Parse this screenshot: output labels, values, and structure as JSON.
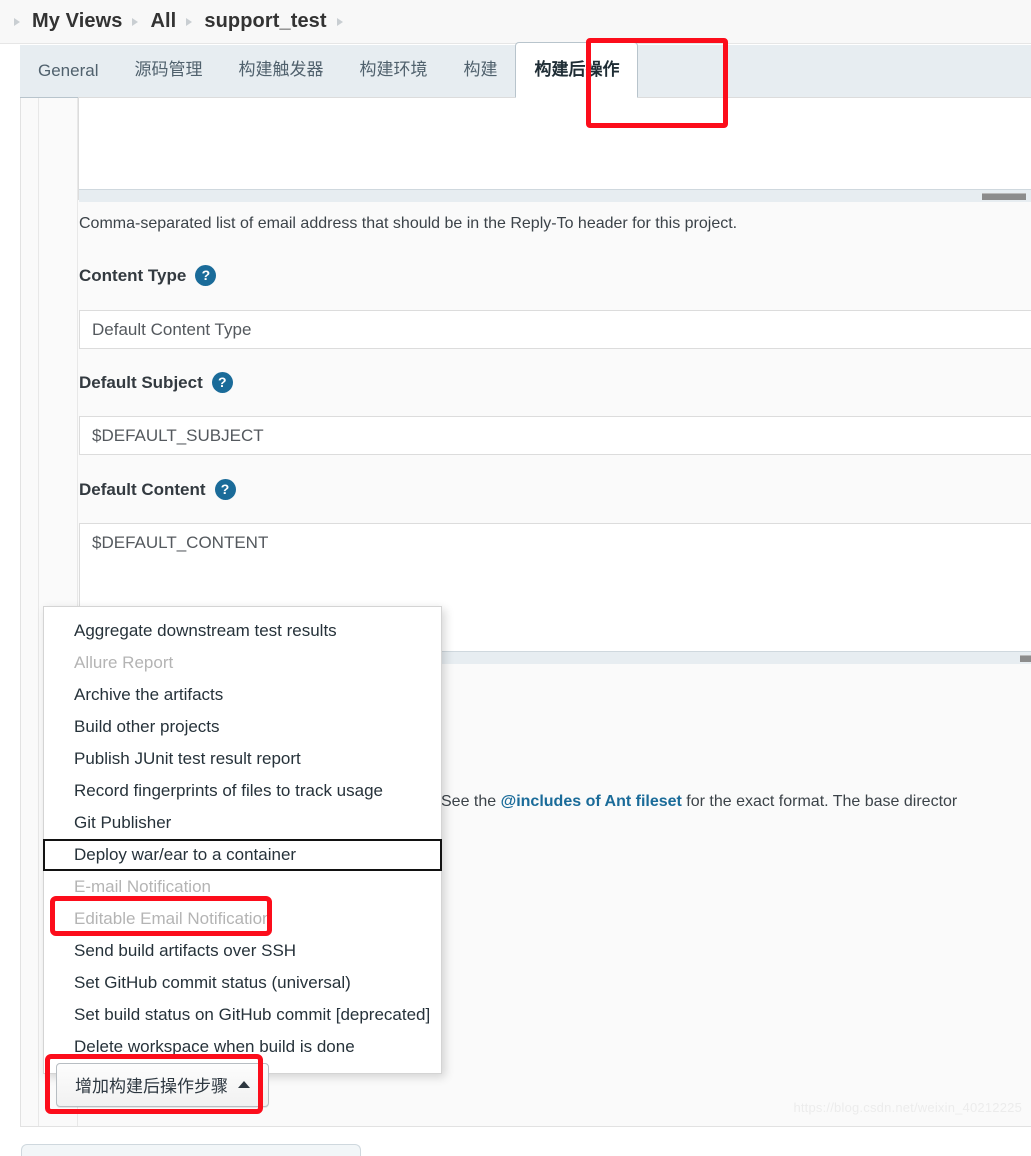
{
  "breadcrumb": {
    "items": [
      {
        "label": "My Views"
      },
      {
        "label": "All"
      },
      {
        "label": "support_test"
      }
    ]
  },
  "tabs": [
    {
      "label": "General",
      "active": false,
      "cjk": false
    },
    {
      "label": "源码管理",
      "active": false,
      "cjk": true
    },
    {
      "label": "构建触发器",
      "active": false,
      "cjk": true
    },
    {
      "label": "构建环境",
      "active": false,
      "cjk": true
    },
    {
      "label": "构建",
      "active": false,
      "cjk": true
    },
    {
      "label": "构建后操作",
      "active": true,
      "cjk": true
    }
  ],
  "form": {
    "reply_to_help": "Comma-separated list of email address that should be in the Reply-To header for this project.",
    "content_type": {
      "label": "Content Type",
      "help_icon": "help-circle-icon",
      "value": "Default Content Type"
    },
    "default_subject": {
      "label": "Default Subject",
      "help_icon": "help-circle-icon",
      "value": "$DEFAULT_SUBJECT"
    },
    "default_content": {
      "label": "Default Content",
      "help_icon": "help-circle-icon",
      "value": "$DEFAULT_CONTENT"
    },
    "ant_fileset_help": {
      "prefix": "See the ",
      "link": "@includes of Ant fileset",
      "suffix": " for the exact format. The base director"
    }
  },
  "dropdown": {
    "items": [
      {
        "label": "Aggregate downstream test results",
        "state": "enabled"
      },
      {
        "label": "Allure Report",
        "state": "disabled"
      },
      {
        "label": "Archive the artifacts",
        "state": "enabled"
      },
      {
        "label": "Build other projects",
        "state": "enabled"
      },
      {
        "label": "Publish JUnit test result report",
        "state": "enabled"
      },
      {
        "label": "Record fingerprints of files to track usage",
        "state": "enabled"
      },
      {
        "label": "Git Publisher",
        "state": "enabled"
      },
      {
        "label": "Deploy war/ear to a container",
        "state": "focused"
      },
      {
        "label": "E-mail Notification",
        "state": "disabled"
      },
      {
        "label": "Editable Email Notification",
        "state": "disabled"
      },
      {
        "label": "Send build artifacts over SSH",
        "state": "enabled"
      },
      {
        "label": "Set GitHub commit status (universal)",
        "state": "enabled"
      },
      {
        "label": "Set build status on GitHub commit [deprecated]",
        "state": "enabled"
      },
      {
        "label": "Delete workspace when build is done",
        "state": "enabled"
      }
    ]
  },
  "add_step_button": {
    "label": "增加构建后操作步骤",
    "caret_icon": "caret-up-icon"
  },
  "annotations": {
    "tab_highlight_target": "构建后操作",
    "menu_highlight_target": "Editable Email Notification",
    "button_highlight_target": "增加构建后操作步骤",
    "highlight_color": "#fc0d1b"
  },
  "watermark": "https://blog.csdn.net/weixin_40212225",
  "colors": {
    "accent": "#1a6b99",
    "tab_bar_bg": "#e7edf1",
    "panel_bg": "#fafafa",
    "link": "#1a6b99"
  }
}
